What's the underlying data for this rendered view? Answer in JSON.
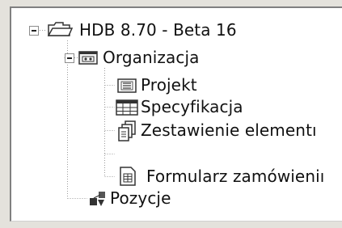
{
  "tree": {
    "root": {
      "label": "HDB 8.70 - Beta 16",
      "icon": "open-folder-icon",
      "children": [
        {
          "label": "Organizacja",
          "icon": "cassette-icon",
          "children": [
            {
              "label": "Projekt",
              "icon": "project-card-icon"
            },
            {
              "label": "Specyfikacja",
              "icon": "table-grid-icon"
            },
            {
              "label": "Zestawienie elementı",
              "icon": "stacked-documents-icon"
            },
            {
              "label": "Formularz zamówieniı",
              "icon": "form-document-icon"
            }
          ]
        },
        {
          "label": "Pozycje",
          "icon": "shapes-icon"
        }
      ]
    }
  }
}
